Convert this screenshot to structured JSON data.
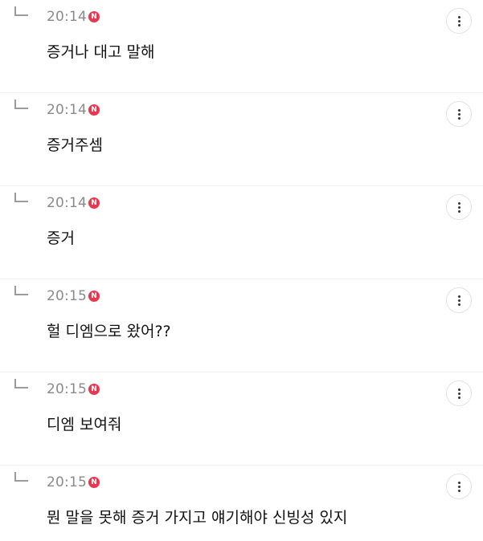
{
  "badge_label": "N",
  "colors": {
    "badge": "#e8384f",
    "time": "#8a8a8a",
    "text": "#111111",
    "divider": "#eeeeee"
  },
  "replies": [
    {
      "time": "20:14",
      "text": "증거나 대고 말해"
    },
    {
      "time": "20:14",
      "text": "증거주셈"
    },
    {
      "time": "20:14",
      "text": "증거"
    },
    {
      "time": "20:15",
      "text": "헐 디엠으로 왔어??"
    },
    {
      "time": "20:15",
      "text": "디엠 보여줘"
    },
    {
      "time": "20:15",
      "text": "뭔 말을 못해 증거 가지고 얘기해야 신빙성 있지"
    }
  ]
}
